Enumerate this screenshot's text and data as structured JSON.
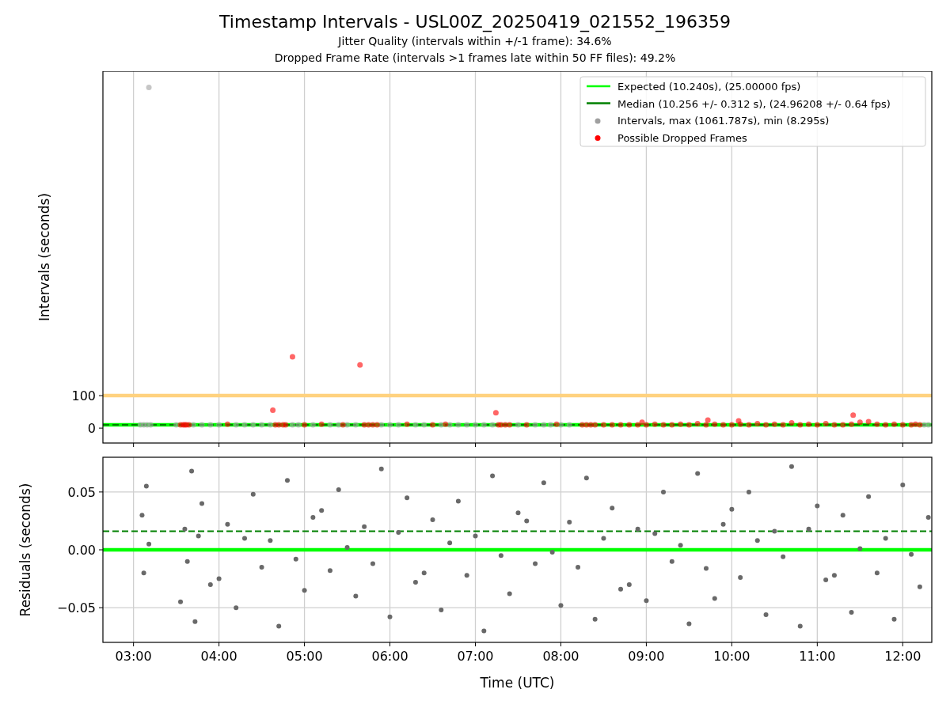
{
  "figure": {
    "title": "Timestamp Intervals - USL00Z_20250419_021552_196359",
    "subtitles": [
      "Jitter Quality (intervals within +/-1 frame): 34.6%",
      "Dropped Frame Rate (intervals >1 frames late within 50 FF files): 49.2%"
    ]
  },
  "panels": [
    {
      "chart_data": {
        "type": "scatter",
        "ylabel": "Intervals (seconds)",
        "grid": true,
        "xlim": [
          2.642,
          12.34
        ],
        "ylim": [
          -46,
          1100
        ],
        "yticks": [
          {
            "value": 0,
            "label": "0"
          },
          {
            "value": 100,
            "label": "100"
          }
        ],
        "series": [
          {
            "name": "Intervals, max (1061.787s), min (8.295s)",
            "color": "#a0a0a0",
            "x": [
              3.08,
              3.12,
              3.16,
              3.2,
              3.18,
              3.5,
              3.7,
              3.8,
              3.9,
              4.0,
              4.2,
              4.3,
              4.4,
              4.5,
              4.6,
              4.86,
              4.93,
              5.1,
              5.3,
              5.4,
              5.5,
              5.6,
              5.9,
              6.0,
              6.1,
              6.3,
              6.4,
              6.6,
              6.7,
              6.8,
              6.9,
              7.0,
              7.1,
              7.2,
              7.5,
              7.7,
              7.8,
              7.88,
              8.0,
              8.1,
              12.25,
              12.3
            ],
            "values": [
              10,
              10,
              10,
              10,
              1050,
              10,
              10,
              10,
              10,
              10,
              10,
              10,
              10,
              10,
              10,
              10,
              10,
              10,
              10,
              10,
              10,
              10,
              10,
              10,
              10,
              10,
              10,
              10,
              10,
              10,
              10,
              10,
              10,
              10,
              10,
              10,
              10,
              10,
              10,
              10,
              10,
              10
            ]
          },
          {
            "name": "Possible Dropped Frames",
            "color": "#ff0000",
            "x": [
              3.55,
              3.58,
              3.6,
              3.62,
              3.65,
              4.1,
              4.63,
              4.66,
              4.7,
              4.75,
              4.78,
              4.86,
              5.0,
              5.2,
              5.45,
              5.65,
              5.7,
              5.75,
              5.8,
              5.85,
              6.2,
              6.5,
              6.65,
              7.24,
              7.27,
              7.3,
              7.35,
              7.4,
              7.6,
              7.95,
              8.25,
              8.3,
              8.35,
              8.4,
              8.5,
              8.6,
              8.7,
              8.8,
              8.9,
              8.95,
              9.0,
              9.1,
              9.2,
              9.3,
              9.4,
              9.5,
              9.6,
              9.7,
              9.72,
              9.8,
              9.9,
              10.0,
              10.08,
              10.1,
              10.2,
              10.3,
              10.4,
              10.5,
              10.6,
              10.7,
              10.8,
              10.9,
              11.0,
              11.1,
              11.2,
              11.3,
              11.4,
              11.42,
              11.5,
              11.6,
              11.7,
              11.8,
              11.9,
              12.0,
              12.1,
              12.15,
              12.2
            ],
            "values": [
              10,
              10,
              10,
              10,
              10,
              12,
              55,
              10,
              10,
              10,
              10,
              220,
              10,
              12,
              10,
              195,
              10,
              10,
              10,
              10,
              12,
              10,
              12,
              47,
              10,
              10,
              10,
              10,
              10,
              12,
              10,
              10,
              10,
              10,
              10,
              10,
              10,
              10,
              10,
              18,
              10,
              12,
              10,
              10,
              12,
              10,
              14,
              10,
              25,
              12,
              10,
              10,
              22,
              12,
              10,
              14,
              10,
              12,
              10,
              16,
              10,
              12,
              10,
              14,
              10,
              10,
              12,
              40,
              18,
              20,
              12,
              10,
              12,
              10,
              10,
              12,
              10
            ]
          }
        ],
        "ref_lines": [
          {
            "axis": "y",
            "value": 100,
            "color": "#ffd27f"
          },
          {
            "axis": "y",
            "value": 10.24,
            "color": "#00ff00",
            "label": "Expected (10.240s), (25.00000 fps)"
          },
          {
            "axis": "y",
            "value": 10.256,
            "color": "#008000",
            "label": "Median (10.256 +/- 0.312 s), (24.96208 +/- 0.64 fps)"
          }
        ],
        "legend": true
      }
    },
    {
      "chart_data": {
        "type": "scatter",
        "xlabel": "Time (UTC)",
        "ylabel": "Residuals (seconds)",
        "grid": true,
        "xlim": [
          2.642,
          12.34
        ],
        "ylim": [
          -0.08,
          0.08
        ],
        "xticks": [
          {
            "value": 3,
            "label": "03:00"
          },
          {
            "value": 4,
            "label": "04:00"
          },
          {
            "value": 5,
            "label": "05:00"
          },
          {
            "value": 6,
            "label": "06:00"
          },
          {
            "value": 7,
            "label": "07:00"
          },
          {
            "value": 8,
            "label": "08:00"
          },
          {
            "value": 9,
            "label": "09:00"
          },
          {
            "value": 10,
            "label": "10:00"
          },
          {
            "value": 11,
            "label": "11:00"
          },
          {
            "value": 12,
            "label": "12:00"
          }
        ],
        "yticks": [
          {
            "value": -0.05,
            "label": "−0.05"
          },
          {
            "value": 0,
            "label": "0.00"
          },
          {
            "value": 0.05,
            "label": "0.05"
          }
        ],
        "series": [
          {
            "color": "#696969",
            "x": [
              3.1,
              3.12,
              3.15,
              3.18,
              3.55,
              3.6,
              3.63,
              3.68,
              3.72,
              3.76,
              3.8,
              3.9,
              4.0,
              4.1,
              4.2,
              4.3,
              4.4,
              4.5,
              4.6,
              4.7,
              4.8,
              4.9,
              5.0,
              5.1,
              5.2,
              5.3,
              5.4,
              5.5,
              5.6,
              5.7,
              5.8,
              5.9,
              6.0,
              6.1,
              6.2,
              6.3,
              6.4,
              6.5,
              6.6,
              6.7,
              6.8,
              6.9,
              7.0,
              7.1,
              7.2,
              7.3,
              7.4,
              7.5,
              7.6,
              7.7,
              7.8,
              7.9,
              8.0,
              8.1,
              8.2,
              8.3,
              8.4,
              8.5,
              8.6,
              8.7,
              8.8,
              8.9,
              9.0,
              9.1,
              9.2,
              9.3,
              9.4,
              9.5,
              9.6,
              9.7,
              9.8,
              9.9,
              10.0,
              10.1,
              10.2,
              10.3,
              10.4,
              10.5,
              10.6,
              10.7,
              10.8,
              10.9,
              11.0,
              11.1,
              11.2,
              11.3,
              11.4,
              11.5,
              11.6,
              11.7,
              11.8,
              11.9,
              12.0,
              12.1,
              12.2,
              12.3
            ],
            "values": [
              0.03,
              -0.02,
              0.055,
              0.005,
              -0.045,
              0.018,
              -0.01,
              0.068,
              -0.062,
              0.012,
              0.04,
              -0.03,
              -0.025,
              0.022,
              -0.05,
              0.01,
              0.048,
              -0.015,
              0.008,
              -0.066,
              0.06,
              -0.008,
              -0.035,
              0.028,
              0.034,
              -0.018,
              0.052,
              0.002,
              -0.04,
              0.02,
              -0.012,
              0.07,
              -0.058,
              0.015,
              0.045,
              -0.028,
              -0.02,
              0.026,
              -0.052,
              0.006,
              0.042,
              -0.022,
              0.012,
              -0.07,
              0.064,
              -0.005,
              -0.038,
              0.032,
              0.025,
              -0.012,
              0.058,
              -0.002,
              -0.048,
              0.024,
              -0.015,
              0.062,
              -0.06,
              0.01,
              0.036,
              -0.034,
              -0.03,
              0.018,
              -0.044,
              0.014,
              0.05,
              -0.01,
              0.004,
              -0.064,
              0.066,
              -0.016,
              -0.042,
              0.022,
              0.035,
              -0.024,
              0.05,
              0.008,
              -0.056,
              0.016,
              -0.006,
              0.072,
              -0.066,
              0.018,
              0.038,
              -0.026,
              -0.022,
              0.03,
              -0.054,
              0.001,
              0.046,
              -0.02,
              0.01,
              -0.06,
              0.056,
              -0.004,
              -0.032,
              0.028
            ]
          }
        ],
        "ref_lines": [
          {
            "axis": "y",
            "value": 0,
            "color": "#00ff00"
          },
          {
            "axis": "y",
            "value": 0.016,
            "color": "#008000"
          }
        ]
      }
    }
  ]
}
